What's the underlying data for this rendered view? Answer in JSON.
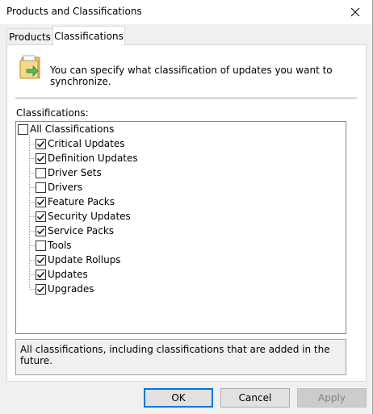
{
  "window": {
    "title": "Products and Classifications"
  },
  "tabs": [
    {
      "label": "Products",
      "selected": false
    },
    {
      "label": "Classifications",
      "selected": true
    }
  ],
  "intro": {
    "text": "You can specify what classification of updates you want to synchronize.",
    "icon": "folder-sync-icon"
  },
  "classifications_label": "Classifications:",
  "tree": {
    "root": {
      "label": "All Classifications",
      "checked": false
    },
    "items": [
      {
        "label": "Critical Updates",
        "checked": true
      },
      {
        "label": "Definition Updates",
        "checked": true
      },
      {
        "label": "Driver Sets",
        "checked": false
      },
      {
        "label": "Drivers",
        "checked": false
      },
      {
        "label": "Feature Packs",
        "checked": true
      },
      {
        "label": "Security Updates",
        "checked": true
      },
      {
        "label": "Service Packs",
        "checked": true
      },
      {
        "label": "Tools",
        "checked": false
      },
      {
        "label": "Update Rollups",
        "checked": true
      },
      {
        "label": "Updates",
        "checked": true
      },
      {
        "label": "Upgrades",
        "checked": true
      }
    ]
  },
  "description": "All classifications, including classifications that are added in the future.",
  "buttons": {
    "ok": "OK",
    "cancel": "Cancel",
    "apply": "Apply"
  },
  "colors": {
    "accent": "#0078d7",
    "dialog_bg": "#f0f0f0"
  }
}
